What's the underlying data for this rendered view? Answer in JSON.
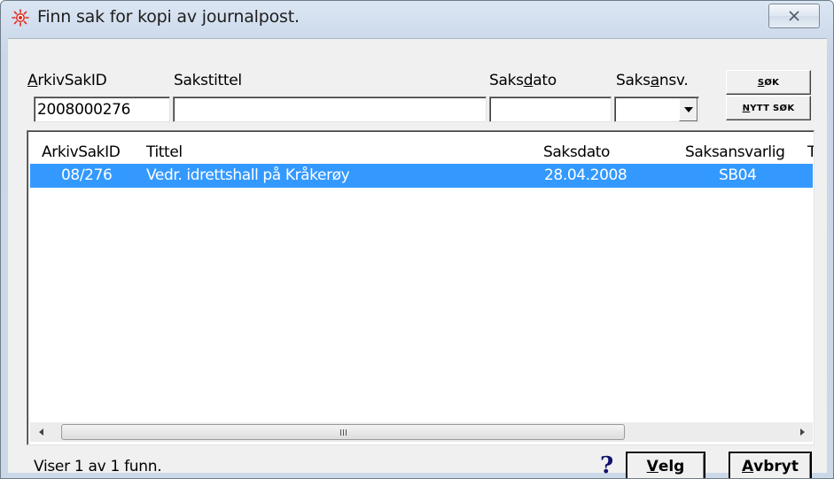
{
  "window": {
    "title": "Finn sak for kopi av journalpost.",
    "close_symbol": "⨯"
  },
  "search": {
    "labels": {
      "arkivsakid_pre": "A",
      "arkivsakid_rest": "rkivSakID",
      "sakstittel": "Sakstittel",
      "saksdato_pre": "Saks",
      "saksdato_u": "d",
      "saksdato_rest": "ato",
      "saksansv_pre": "Saks",
      "saksansv_u": "a",
      "saksansv_rest": "nsv."
    },
    "fields": {
      "arkivsakid_value": "2008000276",
      "sakstittel_value": "",
      "saksdato_value": "",
      "saksansv_value": ""
    },
    "buttons": {
      "sok_u": "S",
      "sok_rest": "ØK",
      "nytt_u": "N",
      "nytt_rest": "YTT SØK"
    }
  },
  "list": {
    "columns": [
      "ArkivSakID",
      "Tittel",
      "Saksdato",
      "Saksansvarlig",
      "T"
    ],
    "rows": [
      {
        "arkivsakid": "08/276",
        "tittel": "Vedr. idrettshall på Kråkerøy",
        "saksdato": "28.04.2008",
        "saksansvarlig": "SB04"
      }
    ],
    "selected_color": "#3399ff"
  },
  "footer": {
    "status": "Viser 1 av 1 funn.",
    "help_symbol": "?",
    "velg_u": "V",
    "velg_rest": "elg",
    "avbryt_u": "A",
    "avbryt_rest": "vbryt"
  }
}
